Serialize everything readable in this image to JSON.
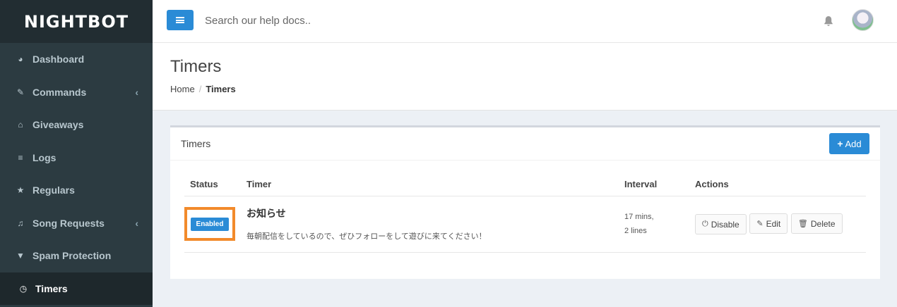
{
  "brand": {
    "logo_text": "NIGHTBOT"
  },
  "sidebar": {
    "items": [
      {
        "label": "Dashboard",
        "icon": "dashboard-icon",
        "glyph": "◕"
      },
      {
        "label": "Commands",
        "icon": "magic-wand-icon",
        "glyph": "✎",
        "has_chevron": true
      },
      {
        "label": "Giveaways",
        "icon": "gift-icon",
        "glyph": "⌂"
      },
      {
        "label": "Logs",
        "icon": "database-icon",
        "glyph": "≡"
      },
      {
        "label": "Regulars",
        "icon": "star-icon",
        "glyph": "★"
      },
      {
        "label": "Song Requests",
        "icon": "music-icon",
        "glyph": "♫",
        "has_chevron": true
      },
      {
        "label": "Spam Protection",
        "icon": "filter-icon",
        "glyph": "▼"
      },
      {
        "label": "Timers",
        "icon": "clock-icon",
        "glyph": "◷",
        "active": true
      }
    ],
    "chevron": "‹"
  },
  "header": {
    "search_placeholder": "Search our help docs..",
    "bell_glyph": "🔔"
  },
  "page": {
    "title": "Timers",
    "breadcrumb": {
      "home": "Home",
      "separator": "/",
      "current": "Timers"
    }
  },
  "box": {
    "title": "Timers",
    "add_label": "Add",
    "add_glyph": "+",
    "columns": [
      "Status",
      "Timer",
      "Interval",
      "Actions"
    ],
    "row": {
      "status": "Enabled",
      "name": "お知らせ",
      "message": "毎朝配信をしているので、ぜひフォローをして遊びに来てください！",
      "interval_line1": "17 mins,",
      "interval_line2": "2 lines",
      "actions": {
        "disable": "Disable",
        "edit": "Edit",
        "delete": "Delete"
      }
    }
  },
  "colors": {
    "accent": "#2a8bd6",
    "sidebar_bg": "#2c3b41",
    "highlight": "#f28a2b"
  }
}
